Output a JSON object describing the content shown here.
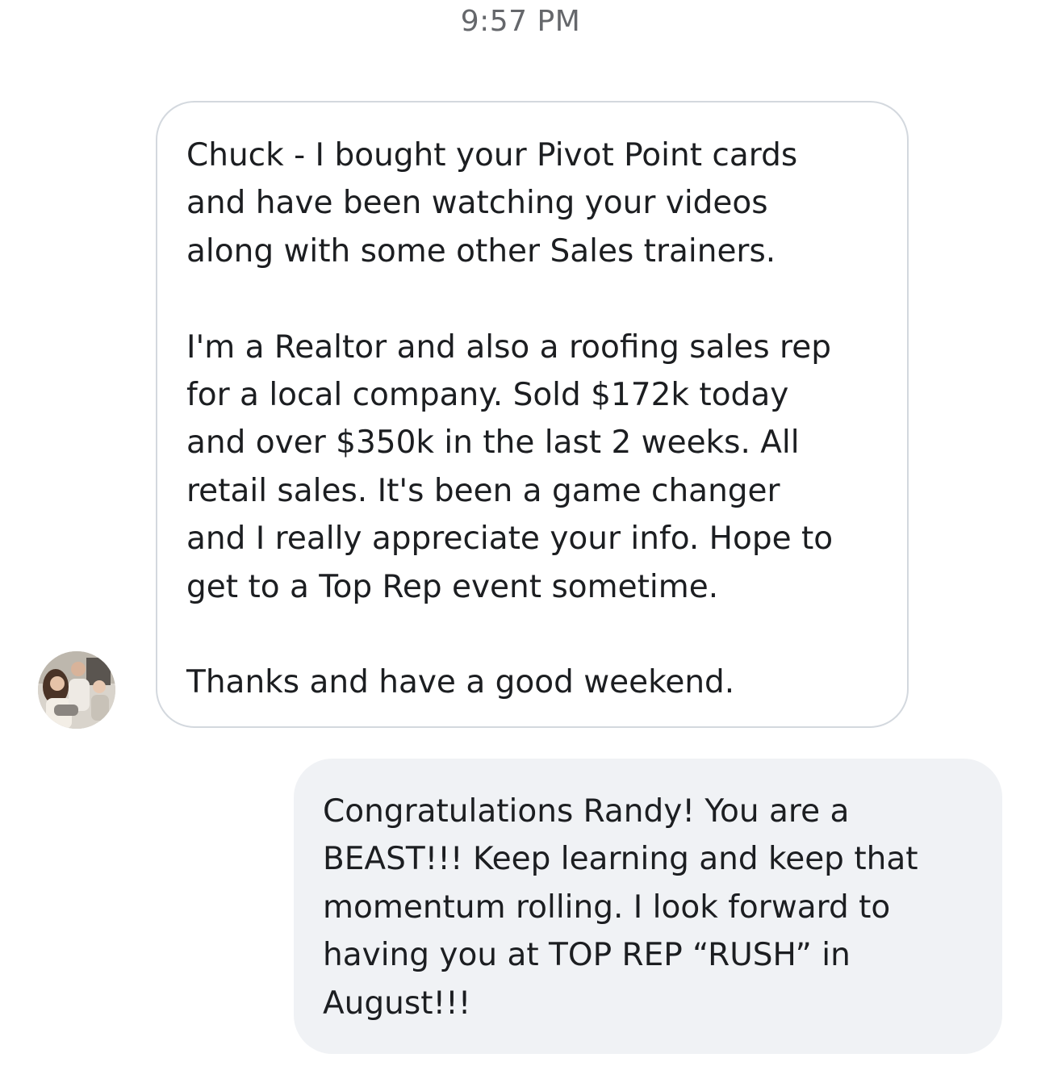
{
  "conversation": {
    "timestamp": "9:57 PM",
    "messages": [
      {
        "sender": "contact",
        "text": "Chuck - I bought your Pivot Point cards\nand have been watching your videos\nalong with some other Sales trainers.\n\nI'm a Realtor and also a roofing sales rep\nfor a local company. Sold $172k today\nand over $350k in the last 2 weeks. All\nretail sales. It's been a game changer\nand I really appreciate your info. Hope to\nget to a Top Rep event sometime.\n\nThanks and have a good weekend."
      },
      {
        "sender": "me",
        "text": "Congratulations Randy!  You are a\nBEAST!!! Keep learning and keep that\nmomentum rolling. I look forward to\nhaving you at TOP REP “RUSH” in\nAugust!!!"
      }
    ]
  },
  "colors": {
    "incoming_border": "#d3d8de",
    "outgoing_bg": "#f0f2f5",
    "text": "#1c1e21",
    "timestamp": "#65676b"
  },
  "icons": {
    "avatar": "contact-avatar-photo"
  }
}
